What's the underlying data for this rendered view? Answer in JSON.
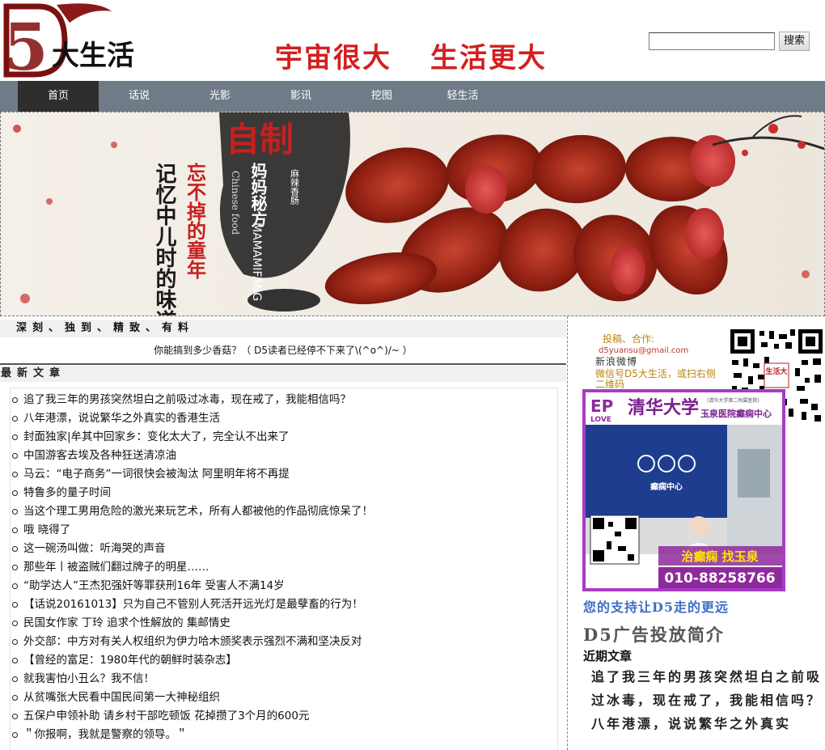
{
  "header": {
    "logo_text": "D5大生活",
    "slogan_left": "宇宙很大",
    "slogan_right": "生活更大",
    "search_value": "",
    "search_button": "搜索"
  },
  "nav": {
    "items": [
      "首页",
      "话说",
      "光影",
      "影讯",
      "挖图",
      "轻生活"
    ],
    "active_index": 0
  },
  "banner": {
    "brand_title": "自制",
    "brand_sub": "妈妈秘方",
    "brand_pinyin": "MAMAMIFANG",
    "brand_small": "麻辣香肠",
    "line1": "忘不掉的童年",
    "line2": "记忆中儿时的味道",
    "vertical_en": "Chinese food"
  },
  "main": {
    "tagline": "深刻、独到、精致、有料",
    "notice": "你能搞到多少香菇？（ D5读者已经停不下来了\\(^o^)/~ ）",
    "section_title": "最新文章",
    "articles": [
      "追了我三年的男孩突然坦白之前吸过冰毒，现在戒了，我能相信吗？",
      "八年港漂，说说繁华之外真实的香港生活",
      "封面独家|牟其中回家乡：变化太大了，完全认不出来了",
      "中国游客去埃及各种狂送清凉油",
      "马云：“电子商务”一词很快会被淘汰 阿里明年将不再提",
      "特鲁多的量子时间",
      "当这个理工男用危险的激光来玩艺术，所有人都被他的作品彻底惊呆了！",
      "哦 晓得了",
      "这一碗汤叫做：听海哭的声音",
      "那些年丨被盗贼们翻过牌子的明星……",
      "“助学达人”王杰犯强奸等罪获刑16年 受害人不满14岁",
      "【话说20161013】只为自己不管别人死活开远光灯是最孽畜的行为！",
      "民国女作家 丁玲 追求个性解放的 集邮情史",
      "外交部：中方对有关人权组织为伊力哈木颁奖表示强烈不满和坚决反对",
      "【曾经的富足：1980年代的朝鲜时装杂志】",
      "就我害怕小丑么？我不信！",
      "从贫嘴张大民看中国民间第一大神秘组织",
      "五保户申领补助 请乡村干部吃顿饭 花掉攒了3个月的600元",
      "＂你报啊，我就是警察的领导。＂"
    ]
  },
  "sidebar": {
    "contact_line1": "投稿、合作:",
    "contact_email": "d5yuansu@gmail.com",
    "weibo": "新浪微博",
    "wechat": "微信号D5大生活，或扫右侧二维码",
    "qr_badge": "生活大",
    "ad": {
      "ep": "EP",
      "love": "LOVE",
      "university": "清华大学",
      "hospital": "玉泉医院癫痫中心",
      "hospital_small": "(清华大学第二附属医院)",
      "center": "癫痫中心",
      "slogan": "治癫痫 找玉泉",
      "phone": "010-88258766"
    },
    "support": "您的支持让D5走的更远",
    "ad_intro": "D5广告投放简介",
    "recent_title": "近期文章",
    "recent_text": "追了我三年的男孩突然坦白之前吸过冰毒，现在戒了，我能相信吗？八年港漂，说说繁华之外真实"
  },
  "colors": {
    "nav_bg": "#6f7c88",
    "nav_active": "#2e2e2e",
    "slogan_red": "#d31f1f",
    "support_blue": "#3d6ec6",
    "ad_border": "#a93bc6",
    "contact_red": "#c0392b"
  }
}
